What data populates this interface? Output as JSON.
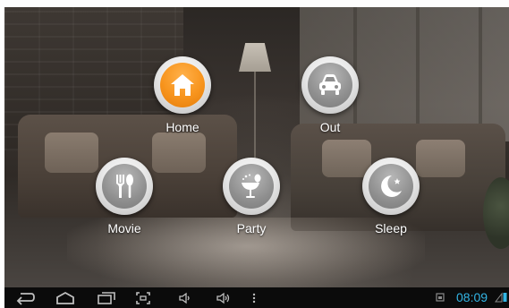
{
  "scenes": [
    {
      "id": "home",
      "label": "Home",
      "icon": "house-icon",
      "active": true
    },
    {
      "id": "out",
      "label": "Out",
      "icon": "car-icon",
      "active": false
    },
    {
      "id": "movie",
      "label": "Movie",
      "icon": "fork-knife-icon",
      "active": false
    },
    {
      "id": "party",
      "label": "Party",
      "icon": "cocktail-balloon-icon",
      "active": false
    },
    {
      "id": "sleep",
      "label": "Sleep",
      "icon": "moon-star-icon",
      "active": false
    }
  ],
  "status_bar": {
    "time": "08:09",
    "time_color": "#33b5e5"
  },
  "nav_icons": [
    "back-icon",
    "home-icon",
    "recent-apps-icon",
    "screenshot-icon",
    "volume-down-icon",
    "volume-up-icon",
    "menu-icon"
  ],
  "colors": {
    "active_scene": "#f7941d",
    "inactive_scene": "#8f8f8f",
    "navbar": "#0b0b0b"
  }
}
